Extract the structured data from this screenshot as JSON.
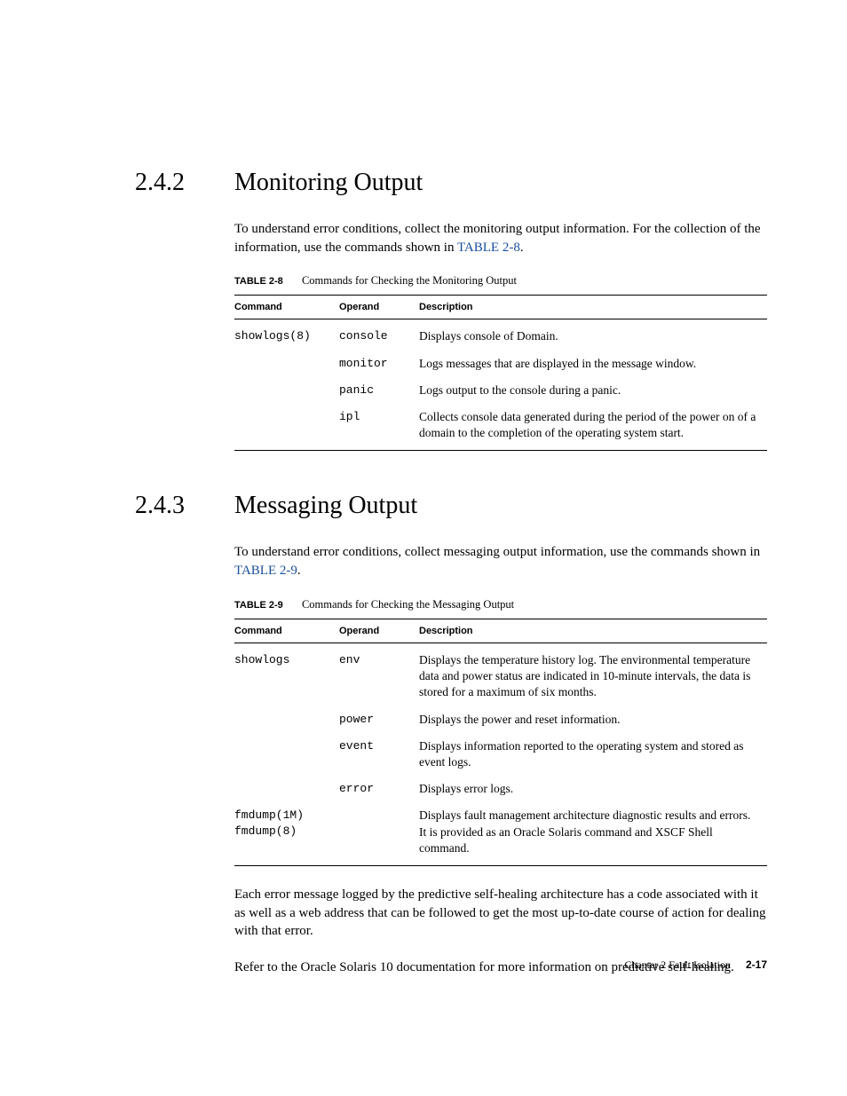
{
  "section242": {
    "number": "2.4.2",
    "title": "Monitoring Output",
    "intro_a": "To understand error conditions, collect the monitoring output information. For the collection of the information, use the commands shown in ",
    "intro_link": "TABLE 2-8",
    "intro_b": "."
  },
  "table28": {
    "label": "TABLE 2-8",
    "caption": "Commands for Checking the Monitoring Output",
    "headers": {
      "c1": "Command",
      "c2": "Operand",
      "c3": "Description"
    },
    "rows": [
      {
        "cmd": "showlogs(8)",
        "op": "console",
        "desc": "Displays console of Domain."
      },
      {
        "cmd": "",
        "op": "monitor",
        "desc": "Logs messages that are displayed in the message window."
      },
      {
        "cmd": "",
        "op": "panic",
        "desc": "Logs output to the console during a panic."
      },
      {
        "cmd": "",
        "op": "ipl",
        "desc": "Collects console data generated during the period of the power on of a domain to the completion of the operating system start."
      }
    ]
  },
  "section243": {
    "number": "2.4.3",
    "title": "Messaging Output",
    "intro_a": "To understand error conditions, collect messaging output information, use the commands shown in ",
    "intro_link": "TABLE 2-9",
    "intro_b": "."
  },
  "table29": {
    "label": "TABLE 2-9",
    "caption": "Commands for Checking the Messaging Output",
    "headers": {
      "c1": "Command",
      "c2": "Operand",
      "c3": "Description"
    },
    "rows": [
      {
        "cmd": "showlogs",
        "op": "env",
        "desc": "Displays the temperature history log. The environmental temperature data and power status are indicated in 10-minute intervals, the data is stored for a maximum of six months."
      },
      {
        "cmd": "",
        "op": "power",
        "desc": "Displays the power and reset information."
      },
      {
        "cmd": "",
        "op": "event",
        "desc": "Displays information reported to the operating system and stored as event logs."
      },
      {
        "cmd": "",
        "op": "error",
        "desc": "Displays error logs."
      },
      {
        "cmd_multi": [
          "fmdump(1M)",
          "fmdump(8)"
        ],
        "op": "",
        "desc": "Displays fault management architecture diagnostic results and errors. It is provided as an Oracle Solaris command and XSCF Shell command."
      }
    ]
  },
  "trailing": {
    "p1": "Each error message logged by the predictive self-healing architecture has a code associated with it as well as a web address that can be followed to get the most up-to-date course of action for dealing with that error.",
    "p2": "Refer to the Oracle Solaris 10 documentation for more information on predictive self-healing."
  },
  "footer": {
    "chapter": "Chapter 2    Fault Isolation",
    "page": "2-17"
  }
}
